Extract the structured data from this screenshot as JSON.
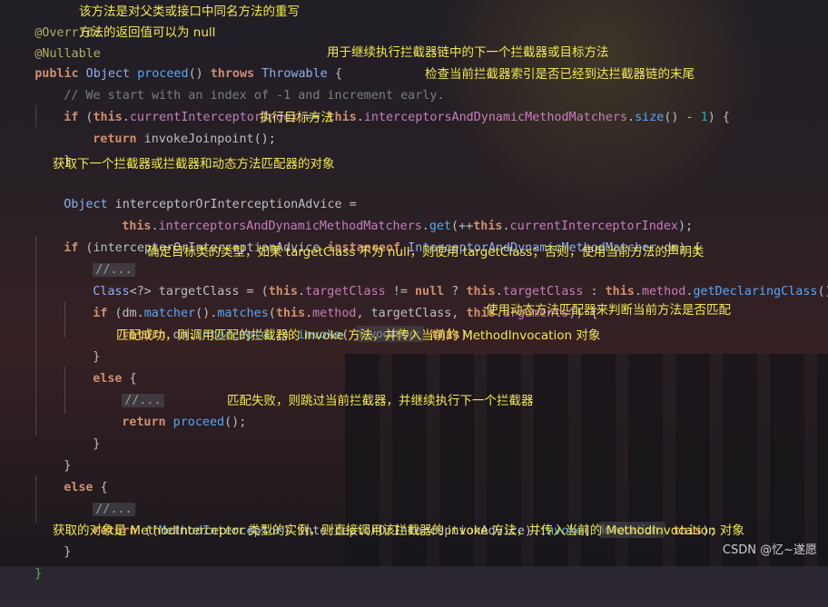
{
  "lines": {
    "l1": "@Override",
    "l2": "@Nullable",
    "l3a": "public",
    "l3b": " Object ",
    "l3c": "proceed",
    "l3d": "() ",
    "l3e": "throws",
    "l3f": " Throwable ",
    "l3g": "{",
    "l4": "// We start with an index of -1 and increment early.",
    "l5a": "if",
    "l5b": " (",
    "l5c": "this",
    "l5d": ".",
    "l5e": "currentInterceptorIndex",
    "l5f": " == ",
    "l5g": "this",
    "l5h": ".",
    "l5i": "interceptorsAndDynamicMethodMatchers",
    "l5j": ".",
    "l5k": "size",
    "l5l": "() - ",
    "l5m": "1",
    "l5n": ") {",
    "l6a": "return",
    "l6b": " invokeJoinpoint",
    "l6c": "();",
    "l7": "}",
    "l9a": "Object",
    "l9b": " interceptorOrInterceptionAdvice =",
    "l10a": "this",
    "l10b": ".",
    "l10c": "interceptorsAndDynamicMethodMatchers",
    "l10d": ".",
    "l10e": "get",
    "l10f": "(++",
    "l10g": "this",
    "l10h": ".",
    "l10i": "currentInterceptorIndex",
    "l10j": ");",
    "l11a": "if",
    "l11b": " (interceptorOrInterceptionAdvice ",
    "l11c": "instanceof",
    "l11d": " InterceptorAndDynamicMethodMatcher",
    "l11e": " dm) {",
    "l12": "//...",
    "l13a": "Class",
    "l13b": "<?> targetClass = (",
    "l13c": "this",
    "l13d": ".",
    "l13e": "targetClass",
    "l13f": " != ",
    "l13g": "null",
    "l13h": " ? ",
    "l13i": "this",
    "l13j": ".",
    "l13k": "targetClass",
    "l13l": " : ",
    "l13m": "this",
    "l13n": ".",
    "l13o": "method",
    "l13p": ".",
    "l13q": "getDeclaringClass",
    "l13r": "());",
    "l14a": "if",
    "l14b": " (dm.",
    "l14c": "matcher",
    "l14d": "().",
    "l14e": "matches",
    "l14f": "(",
    "l14g": "this",
    "l14h": ".",
    "l14i": "method",
    "l14j": ", targetClass, ",
    "l14k": "this",
    "l14l": ".",
    "l14m": "arguments",
    "l14n": ")) {",
    "l15a": "return",
    "l15b": " dm.",
    "l15c": "interceptor",
    "l15d": "().",
    "l15e": "invoke",
    "l15f": "( ",
    "l15hint": "invocation:",
    "l15g": " this",
    "l15h": ");",
    "l16": "}",
    "l17a": "else",
    "l17b": " {",
    "l18": "//...",
    "l19a": "return",
    "l19b": " proceed",
    "l19c": "();",
    "l20": "}",
    "l21": "}",
    "l22a": "else",
    "l22b": " {",
    "l23": "//...",
    "l24a": "return",
    "l24b": " ((",
    "l24c": "MethodInterceptor",
    "l24d": ") interceptorOrInterceptionAdvice).",
    "l24e": "invoke",
    "l24f": "( ",
    "l24hint": "invocation:",
    "l24g": " this",
    "l24h": ");",
    "l25": "}",
    "l26": "}"
  },
  "annotations": {
    "a1": "该方法是对父类或接口中同名方法的重写",
    "a2": "方法的返回值可以为 null",
    "a3": "用于继续执行拦截器链中的下一个拦截器或目标方法",
    "a4": "检查当前拦截器索引是否已经到达拦截器链的末尾",
    "a6": "执行目标方法",
    "a8": "获取下一个拦截器或拦截器和动态方法匹配器的对象",
    "a12": "确定目标类的类型，如果 targetClass 不为 null，则使用 targetClass；否则，使用当前方法的声明类",
    "a15": "使用动态方法匹配器来判断当前方法是否匹配",
    "a16": "匹配成功，则调用匹配的拦截器的 invoke 方法，并传入当前的 MethodInvocation 对象",
    "a19": "匹配失败，则跳过当前拦截器，并继续执行下一个拦截器",
    "a25": "获取的对象是 MethodInterceptor 类型的实例，则直接调用该拦截器的 invoke 方法，并传入当前的 MethodInvocation 对象"
  },
  "watermark": "CSDN @忆~遂愿",
  "colors": {
    "keyword": "#cf8e6d",
    "annotation_text": "#f2e94e",
    "method": "#56a8f5",
    "field": "#c77dbb",
    "comment": "#7a7e85",
    "number": "#2aacb8"
  }
}
